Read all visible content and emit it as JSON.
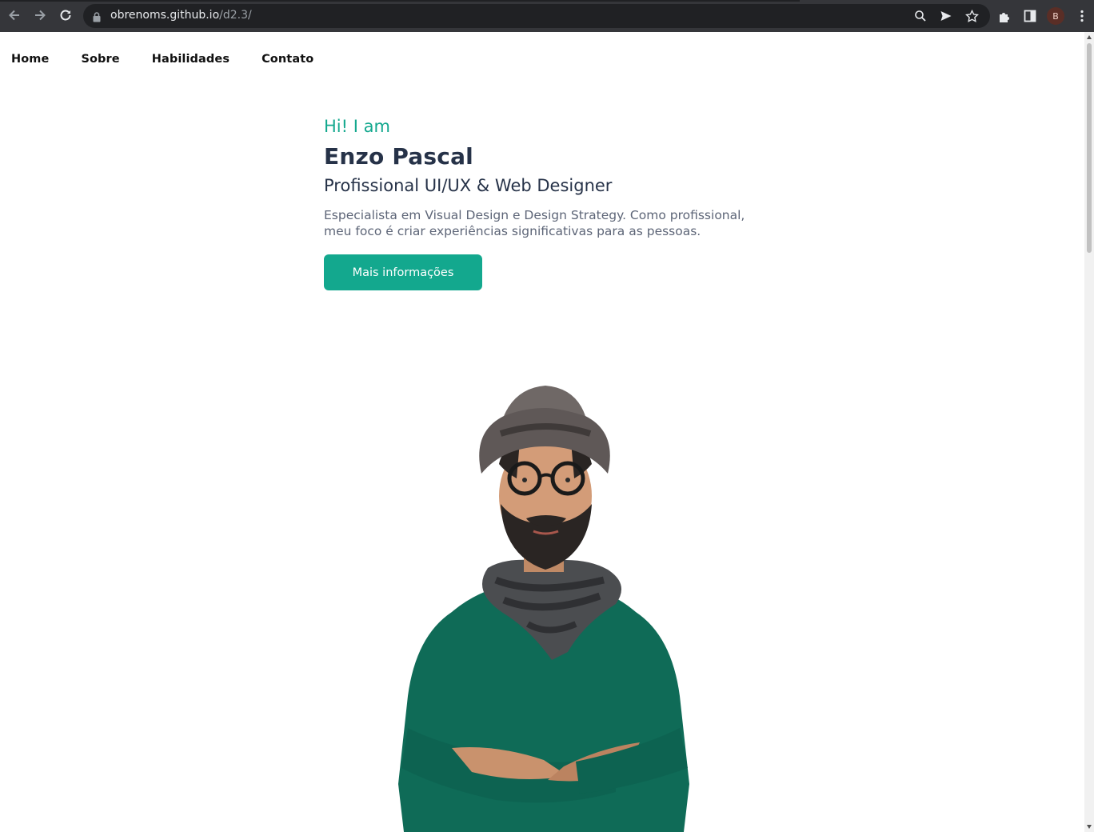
{
  "browser": {
    "url_host": "obrenoms.github.io",
    "url_path": "/d2.3/",
    "profile_initial": "B",
    "icons": [
      "back-icon",
      "forward-icon",
      "reload-icon",
      "lock-icon",
      "zoom-icon",
      "send-icon",
      "bookmark-star-icon",
      "extensions-icon",
      "side-panel-icon",
      "kebab-menu-icon"
    ]
  },
  "nav": {
    "items": [
      {
        "label": "Home"
      },
      {
        "label": "Sobre"
      },
      {
        "label": "Habilidades"
      },
      {
        "label": "Contato"
      }
    ]
  },
  "hero": {
    "greeting": "Hi! I am",
    "name": "Enzo Pascal",
    "role": "Profissional UI/UX & Web Designer",
    "description": "Especialista em Visual Design e Design Strategy. Como profissional, meu foco é criar experiências significativas para as pessoas.",
    "cta_label": "Mais informações"
  },
  "colors": {
    "accent": "#13a88e",
    "heading": "#263248",
    "body_text": "#5d6577",
    "sweater": "#0f6b57"
  }
}
